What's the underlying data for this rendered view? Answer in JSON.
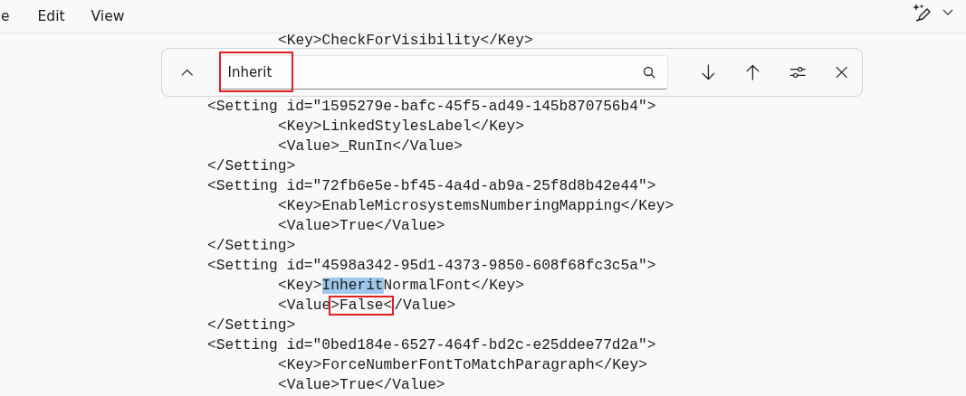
{
  "menu": [
    "e",
    "Edit",
    "View"
  ],
  "find_bar": {
    "value": "Inherit",
    "annotated": true
  },
  "code": [
    {
      "kind": "inner",
      "parts": [
        {
          "text": "<Key>CheckForVisibility</Key>"
        }
      ]
    },
    {
      "kind": "outer",
      "parts": [
        {
          "text": "<Setting id=\"1595279e-bafc-45f5-ad49-145b870756b4\">"
        }
      ]
    },
    {
      "kind": "inner",
      "parts": [
        {
          "text": "<Key>LinkedStylesLabel</Key>"
        }
      ]
    },
    {
      "kind": "inner",
      "parts": [
        {
          "text": "<Value>_RunIn</Value>"
        }
      ]
    },
    {
      "kind": "outer",
      "parts": [
        {
          "text": "</Setting>"
        }
      ]
    },
    {
      "kind": "outer",
      "parts": [
        {
          "text": "<Setting id=\"72fb6e5e-bf45-4a4d-ab9a-25f8d8b42e44\">"
        }
      ]
    },
    {
      "kind": "inner",
      "parts": [
        {
          "text": "<Key>EnableMicrosystemsNumberingMapping</Key>"
        }
      ]
    },
    {
      "kind": "inner",
      "parts": [
        {
          "text": "<Value>True</Value>"
        }
      ]
    },
    {
      "kind": "outer",
      "parts": [
        {
          "text": "</Setting>"
        }
      ]
    },
    {
      "kind": "outer",
      "parts": [
        {
          "text": "<Setting id=\"4598a342-95d1-4373-9850-608f68fc3c5a\">"
        }
      ]
    },
    {
      "kind": "inner",
      "parts": [
        {
          "text": "<Key>"
        },
        {
          "text": "Inherit",
          "match": true
        },
        {
          "text": "NormalFont</Key>"
        }
      ]
    },
    {
      "kind": "inner",
      "parts": [
        {
          "text": "<Value"
        },
        {
          "text": ">False<",
          "boxed": true
        },
        {
          "text": "/Value>"
        }
      ]
    },
    {
      "kind": "outer",
      "parts": [
        {
          "text": "</Setting>"
        }
      ]
    },
    {
      "kind": "outer",
      "parts": [
        {
          "text": "<Setting id=\"0bed184e-6527-464f-bd2c-e25ddee77d2a\">"
        }
      ]
    },
    {
      "kind": "inner",
      "parts": [
        {
          "text": "<Key>ForceNumberFontToMatchParagraph</Key>"
        }
      ]
    },
    {
      "kind": "inner",
      "parts": [
        {
          "text": "<Value>True</Value>"
        }
      ]
    }
  ]
}
